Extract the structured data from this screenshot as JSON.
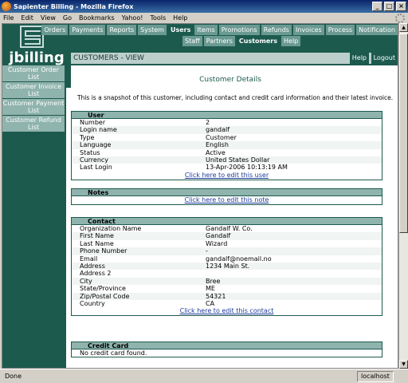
{
  "window": {
    "title": "Sapienter Billing - Mozilla Firefox"
  },
  "menu": [
    "File",
    "Edit",
    "View",
    "Go",
    "Bookmarks",
    "Yahoo!",
    "Tools",
    "Help"
  ],
  "brand": "jbilling",
  "nav": {
    "row1": [
      "Orders",
      "Payments",
      "Reports",
      "System",
      "Users",
      "Items",
      "Promotions",
      "Refunds",
      "Invoices",
      "Process",
      "Notification"
    ],
    "row2": [
      "Staff",
      "Partners",
      "Customers",
      "Help"
    ],
    "active_row1": "Users",
    "active_row2": "Customers"
  },
  "view": {
    "title": "CUSTOMERS - VIEW",
    "help": "Help",
    "logout": "Logout"
  },
  "sidebar": [
    "Customer Order List",
    "Customer Invoice List",
    "Customer Payment List",
    "Customer Refund List"
  ],
  "content": {
    "heading": "Customer Details",
    "intro": "This is a snapshot of this customer, including contact and credit card information and their latest invoice."
  },
  "user": {
    "header": "User",
    "rows": [
      [
        "Number",
        "2"
      ],
      [
        "Login name",
        "gandalf"
      ],
      [
        "Type",
        "Customer"
      ],
      [
        "Language",
        "English"
      ],
      [
        "Status",
        "Active"
      ],
      [
        "Currency",
        "United States Dollar"
      ],
      [
        "Last Login",
        "13-Apr-2006 10:13:19 AM"
      ]
    ],
    "link": "Click here to edit this user"
  },
  "notes": {
    "header": "Notes",
    "link": "Click here to edit this note"
  },
  "contact": {
    "header": "Contact",
    "rows": [
      [
        "Organization Name",
        "Gandalf W. Co."
      ],
      [
        "First Name",
        "Gandalf"
      ],
      [
        "Last Name",
        "Wizard"
      ],
      [
        "Phone Number",
        "-"
      ],
      [
        "Email",
        "gandalf@noemail.no"
      ],
      [
        "Address",
        "1234 Main St."
      ],
      [
        "Address 2",
        ""
      ],
      [
        "City",
        "Bree"
      ],
      [
        "State/Province",
        "ME"
      ],
      [
        "Zip/Postal Code",
        "54321"
      ],
      [
        "Country",
        "CA"
      ]
    ],
    "link": "Click here to edit this contact"
  },
  "credit_card": {
    "header": "Credit Card",
    "text": "No credit card found."
  },
  "status": {
    "text": "Done",
    "host": "localhost"
  },
  "colors": {
    "brand_green": "#1d5a4e",
    "tab_green": "#6b9a92",
    "header_band": "#8fb3ad"
  }
}
